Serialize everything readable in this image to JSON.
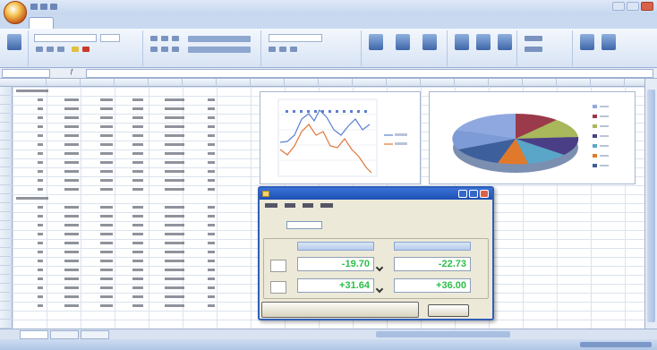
{
  "colors": {
    "accent": "#2f5fb8",
    "value_green": "#2dbf4a",
    "ribbon_bg": "#d7e3f4"
  },
  "dialog": {
    "values": [
      [
        "-19.70",
        "-22.73"
      ],
      [
        "+31.64",
        "+36.00"
      ]
    ]
  },
  "icons": [
    "office-button-icon",
    "close-icon",
    "minimize-icon",
    "maximize-icon",
    "edit-icon",
    "function-icon"
  ]
}
